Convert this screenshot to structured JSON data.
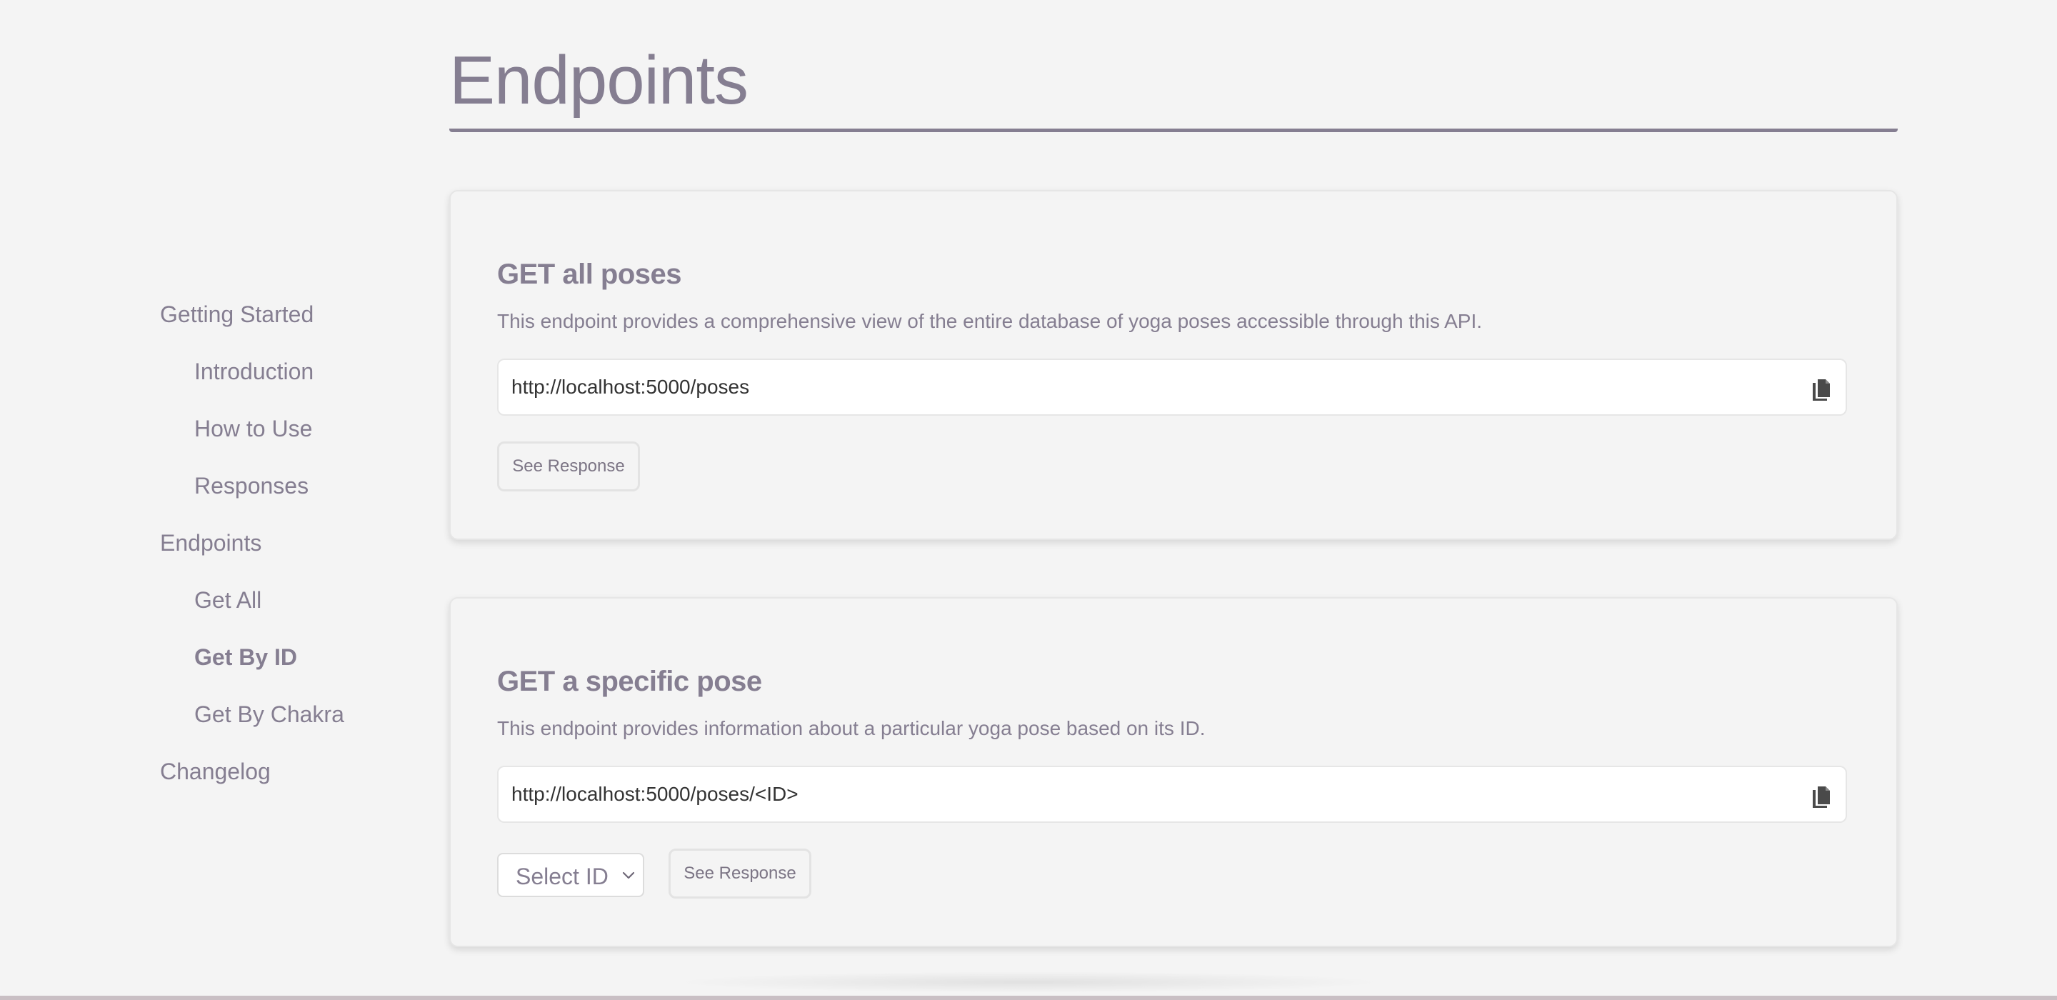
{
  "sidebar": {
    "items": [
      {
        "label": "Getting Started"
      },
      {
        "label": "Introduction"
      },
      {
        "label": "How to Use"
      },
      {
        "label": "Responses"
      },
      {
        "label": "Endpoints"
      },
      {
        "label": "Get All"
      },
      {
        "label": "Get By ID"
      },
      {
        "label": "Get By Chakra"
      },
      {
        "label": "Changelog"
      }
    ],
    "active_item": "Get By ID"
  },
  "main": {
    "title": "Endpoints",
    "cards": [
      {
        "heading": "GET all poses",
        "description": "This endpoint provides a comprehensive view of the entire database of yoga poses accessible through this API.",
        "url": "http://localhost:5000/poses",
        "copy_icon": "copy-icon",
        "button_label": "See Response"
      },
      {
        "heading": "GET a specific pose",
        "description": "This endpoint provides information about a particular yoga pose based on its ID.",
        "url": "http://localhost:5000/poses/<ID>",
        "copy_icon": "copy-icon",
        "select_value": "Select ID",
        "button_label": "See Response"
      }
    ]
  },
  "colors": {
    "background": "#f4f4f4",
    "text": "#857e91",
    "url_text": "#333333",
    "border": "#e6e6e6"
  }
}
